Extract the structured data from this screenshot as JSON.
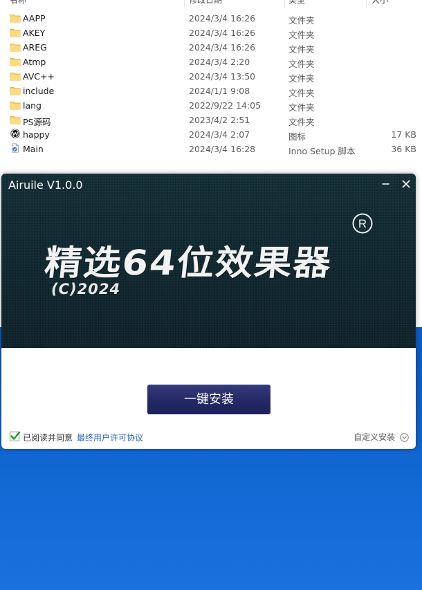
{
  "explorer": {
    "columns": [
      "名称",
      "修改日期",
      "类型",
      "大小"
    ],
    "files": [
      {
        "name": "AAPP",
        "date": "2024/3/4 16:26",
        "type": "文件夹",
        "size": "",
        "icon": "folder-icon"
      },
      {
        "name": "AKEY",
        "date": "2024/3/4 16:26",
        "type": "文件夹",
        "size": "",
        "icon": "folder-icon"
      },
      {
        "name": "AREG",
        "date": "2024/3/4 16:26",
        "type": "文件夹",
        "size": "",
        "icon": "folder-icon"
      },
      {
        "name": "Atmp",
        "date": "2024/3/4 2:20",
        "type": "文件夹",
        "size": "",
        "icon": "folder-icon"
      },
      {
        "name": "AVC++",
        "date": "2024/3/4 13:50",
        "type": "文件夹",
        "size": "",
        "icon": "folder-icon"
      },
      {
        "name": "include",
        "date": "2024/1/1 9:08",
        "type": "文件夹",
        "size": "",
        "icon": "folder-icon"
      },
      {
        "name": "lang",
        "date": "2022/9/22 14:05",
        "type": "文件夹",
        "size": "",
        "icon": "folder-icon"
      },
      {
        "name": "PS源码",
        "date": "2023/4/2 2:51",
        "type": "文件夹",
        "size": "",
        "icon": "folder-icon"
      },
      {
        "name": "happy",
        "date": "2024/3/4 2:07",
        "type": "图标",
        "size": "17 KB",
        "icon": "waves-app-icon"
      },
      {
        "name": "Main",
        "date": "2024/3/4 16:28",
        "type": "Inno Setup 脚本",
        "size": "36 KB",
        "icon": "inno-script-icon"
      }
    ]
  },
  "installer": {
    "title": "Airuile V1.0.0",
    "headline": "精选64位效果器",
    "year": "(C)2024",
    "registered_mark": "R",
    "install_button": "一键安装",
    "agree_label": "已阅读并同意",
    "agree_checked": true,
    "license_link": "最终用户许可协议",
    "custom_install": "自定义安装",
    "icons": {
      "minimize": "minimize-icon",
      "close": "close-icon",
      "check": "checkmark-icon",
      "custom": "chevron-down-circle-icon"
    }
  },
  "colors": {
    "banner": "#112b34",
    "install_button": "#252a66",
    "link": "#2b66c8",
    "folder": "#f8d26a",
    "checkmark": "#1e9b2e",
    "desktop": "#0e66d4"
  }
}
